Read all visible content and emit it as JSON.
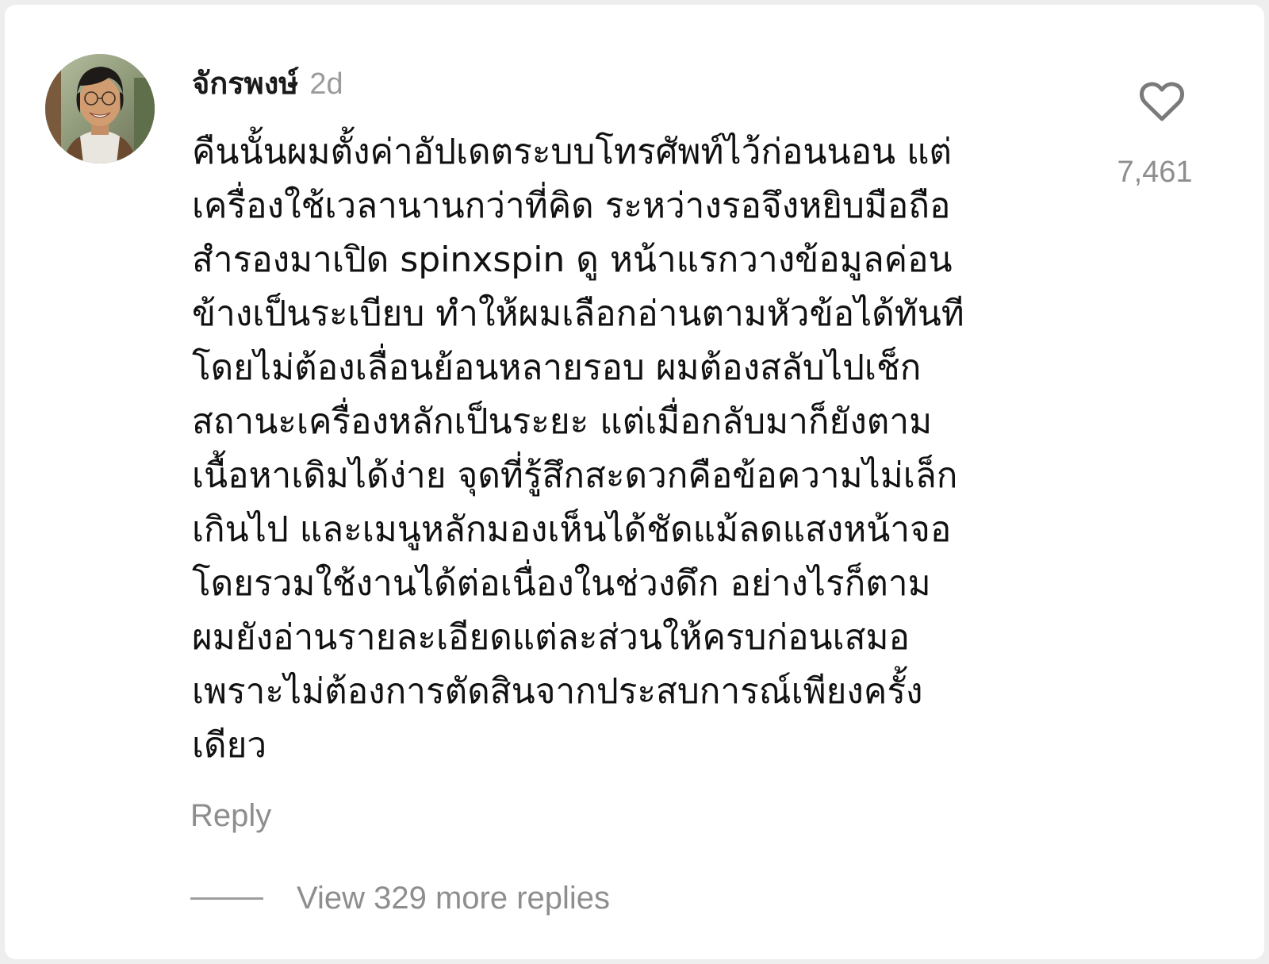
{
  "comment": {
    "username": "จักรพงษ์",
    "time_ago": "2d",
    "avatar_icon": "user-avatar-photo",
    "text_lines": [
      "คืนนั้นผมตั้งค่าอัปเดตระบบโทรศัพท์ไว้ก่อนนอน แต่",
      "เครื่องใช้เวลานานกว่าที่คิด ระหว่างรอจึงหยิบมือถือ",
      "สำรองมาเปิด spinxspin ดู หน้าแรกวางข้อมูลค่อน",
      "ข้างเป็นระเบียบ ทำให้ผมเลือกอ่านตามหัวข้อได้ทันที",
      "โดยไม่ต้องเลื่อนย้อนหลายรอบ ผมต้องสลับไปเช็ก",
      "สถานะเครื่องหลักเป็นระยะ แต่เมื่อกลับมาก็ยังตาม",
      "เนื้อหาเดิมได้ง่าย จุดที่รู้สึกสะดวกคือข้อความไม่เล็ก",
      "เกินไป และเมนูหลักมองเห็นได้ชัดแม้ลดแสงหน้าจอ",
      "โดยรวมใช้งานได้ต่อเนื่องในช่วงดึก อย่างไรก็ตาม",
      "ผมยังอ่านรายละเอียดแต่ละส่วนให้ครบก่อนเสมอ",
      "เพราะไม่ต้องการตัดสินจากประสบการณ์เพียงครั้ง",
      "เดียว"
    ],
    "like_icon": "heart-outline-icon",
    "like_count": "7,461",
    "reply_label": "Reply",
    "view_replies_label": "View 329 more replies"
  }
}
